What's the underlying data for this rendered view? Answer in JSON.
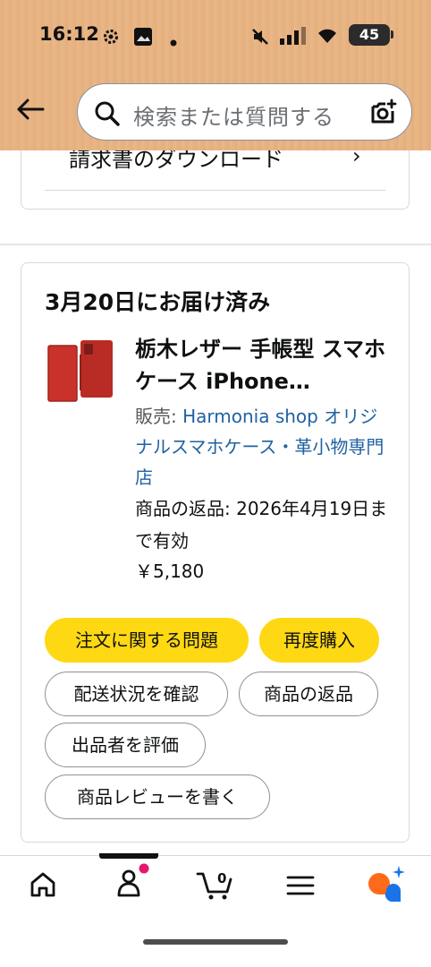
{
  "status_bar": {
    "time": "16:12",
    "battery": "45",
    "icons": [
      "gear-icon",
      "image-icon",
      "dot-icon",
      "mute-icon",
      "signal-icon",
      "wifi-icon",
      "battery-icon"
    ]
  },
  "header": {
    "back_icon": "back-arrow-icon",
    "search": {
      "placeholder": "検索または質問する",
      "icon": "search-icon",
      "camera_icon": "camera-lens-icon"
    }
  },
  "previous_card": {
    "link_label": "請求書のダウンロード",
    "chevron": "›"
  },
  "order": {
    "delivery_status": "3月20日にお届け済み",
    "product_title": "栃木レザー 手帳型 スマホケース iPhone…",
    "seller_label": "販売: ",
    "seller_name": "Harmonia shop オリジナルスマホケース・革小物専門店",
    "return_info": "商品の返品: 2026年4月19日まで有効",
    "price": "￥5,180",
    "buttons": {
      "problem": "注文に関する問題",
      "buy_again": "再度購入",
      "track": "配送状況を確認",
      "return": "商品の返品",
      "rate_seller": "出品者を評価",
      "write_review": "商品レビューを書く"
    }
  },
  "bottom_nav": {
    "items": [
      "home-icon",
      "account-icon",
      "cart-icon",
      "menu-icon",
      "ai-assistant-icon"
    ],
    "cart_count": "0"
  },
  "colors": {
    "header_bg": "#e8b484",
    "yellow_button": "#ffd814",
    "link_blue": "#2162a1",
    "product_red": "#c8322a",
    "notification_dot": "#e3196b",
    "assistant_orange": "#ff6a1a",
    "assistant_blue": "#1a73e8"
  }
}
